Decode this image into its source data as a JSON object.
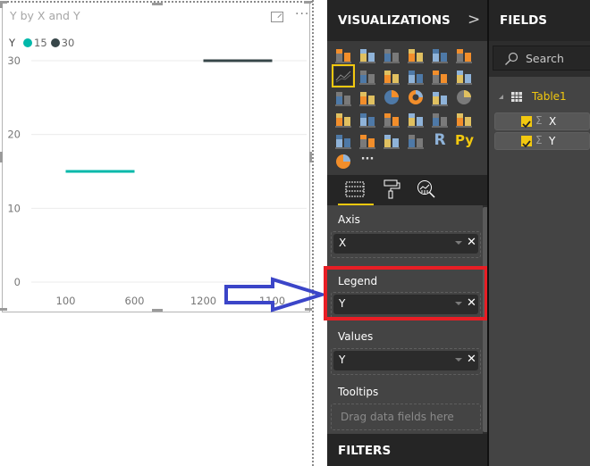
{
  "visual": {
    "title": "Y by X and Y",
    "more_label": "···",
    "legend_title": "Y",
    "legend": [
      {
        "label": "15",
        "color": "#01b8aa"
      },
      {
        "label": "30",
        "color": "#374649"
      }
    ]
  },
  "chart_data": {
    "type": "line",
    "title": "Y by X and Y",
    "xlabel": "",
    "ylabel": "",
    "x_categories": [
      "100",
      "600",
      "1200",
      "1100"
    ],
    "y_ticks": [
      0,
      10,
      20,
      30
    ],
    "ylim": [
      0,
      30
    ],
    "grid": true,
    "legend_position": "top-left",
    "series": [
      {
        "name": "15",
        "color": "#01b8aa",
        "x": [
          "100",
          "600"
        ],
        "values": [
          15,
          15
        ]
      },
      {
        "name": "30",
        "color": "#374649",
        "x": [
          "1200",
          "1100"
        ],
        "values": [
          30,
          30
        ]
      }
    ]
  },
  "visualizations": {
    "title": "VISUALIZATIONS",
    "chevron": ">",
    "gallery": [
      "stacked-bar",
      "stacked-column",
      "clustered-bar",
      "clustered-column",
      "100-stacked-bar",
      "100-stacked-column",
      "line",
      "area",
      "stacked-area",
      "line-clustered-column",
      "line-stacked-column",
      "ribbon",
      "waterfall",
      "scatter",
      "pie",
      "donut",
      "treemap",
      "map",
      "filled-map",
      "shape-map",
      "funnel",
      "gauge",
      "card",
      "multi-row-card",
      "kpi",
      "slicer",
      "table",
      "matrix",
      "r-visual",
      "python-visual",
      "arcgis-map",
      "more"
    ],
    "selected": "line",
    "tabs": [
      "fields-tab",
      "format-tab",
      "analytics-tab"
    ],
    "wells": {
      "axis": {
        "label": "Axis",
        "value": "X"
      },
      "legend": {
        "label": "Legend",
        "value": "Y"
      },
      "values": {
        "label": "Values",
        "value": "Y"
      },
      "tooltips": {
        "label": "Tooltips",
        "placeholder": "Drag data fields here"
      }
    },
    "filters_title": "FILTERS"
  },
  "fields": {
    "title": "FIELDS",
    "search_placeholder": "Search",
    "table": "Table1",
    "items": [
      {
        "name": "X",
        "checked": true,
        "aggregate": "Σ"
      },
      {
        "name": "Y",
        "checked": true,
        "aggregate": "Σ"
      }
    ]
  },
  "annotation": {
    "arrow_color": "#3b45c8",
    "highlight_color": "#e81e25"
  }
}
